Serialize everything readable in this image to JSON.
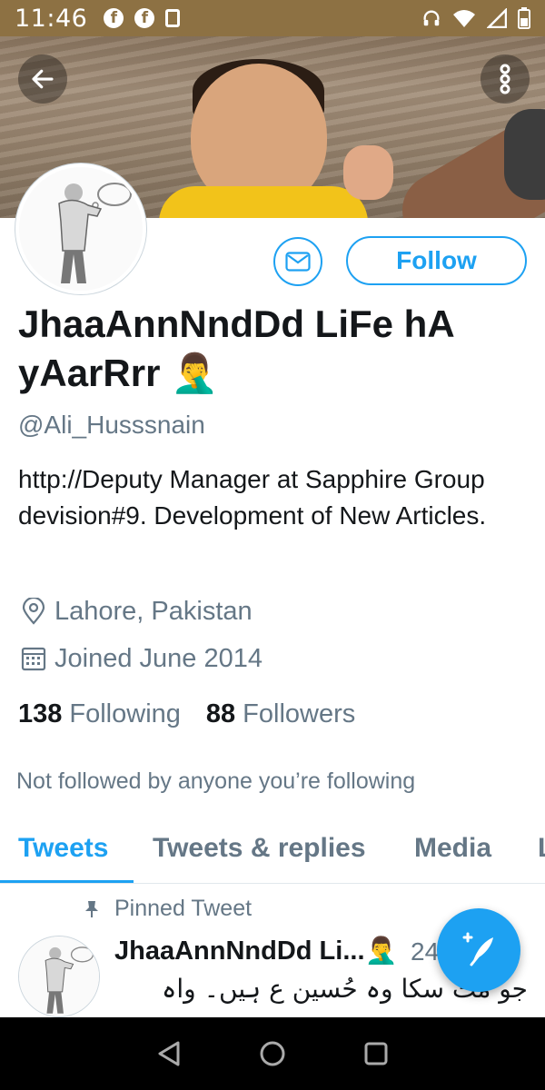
{
  "status_bar": {
    "time": "11:46"
  },
  "profile": {
    "follow_label": "Follow",
    "name": "JhaaAnnNndDd LiFe hA yAarRrr",
    "emoji": "🤦‍♂️",
    "handle": "@Ali_Husssnain",
    "bio": "http://Deputy Manager at Sapphire Group devision#9. Development of New Articles.",
    "location": "Lahore, Pakistan",
    "joined": "Joined June 2014",
    "following_count": "138",
    "following_label": "Following",
    "followers_count": "88",
    "followers_label": "Followers",
    "not_followed": "Not followed by anyone you’re following"
  },
  "tabs": [
    {
      "label": "Tweets",
      "active": true
    },
    {
      "label": "Tweets & replies",
      "active": false
    },
    {
      "label": "Media",
      "active": false
    },
    {
      "label": "L",
      "active": false
    }
  ],
  "pinned_tweet": {
    "pinned_label": "Pinned Tweet",
    "name": "JhaaAnnNndDd Li...",
    "emoji": "🤦‍♂️",
    "meta": "24",
    "text": "جو مٹ سکا وہ حُسین ع ہیں۔ واہ"
  },
  "colors": {
    "accent": "#1da1f2",
    "status_bar": "#8d7143",
    "muted": "#657786"
  }
}
